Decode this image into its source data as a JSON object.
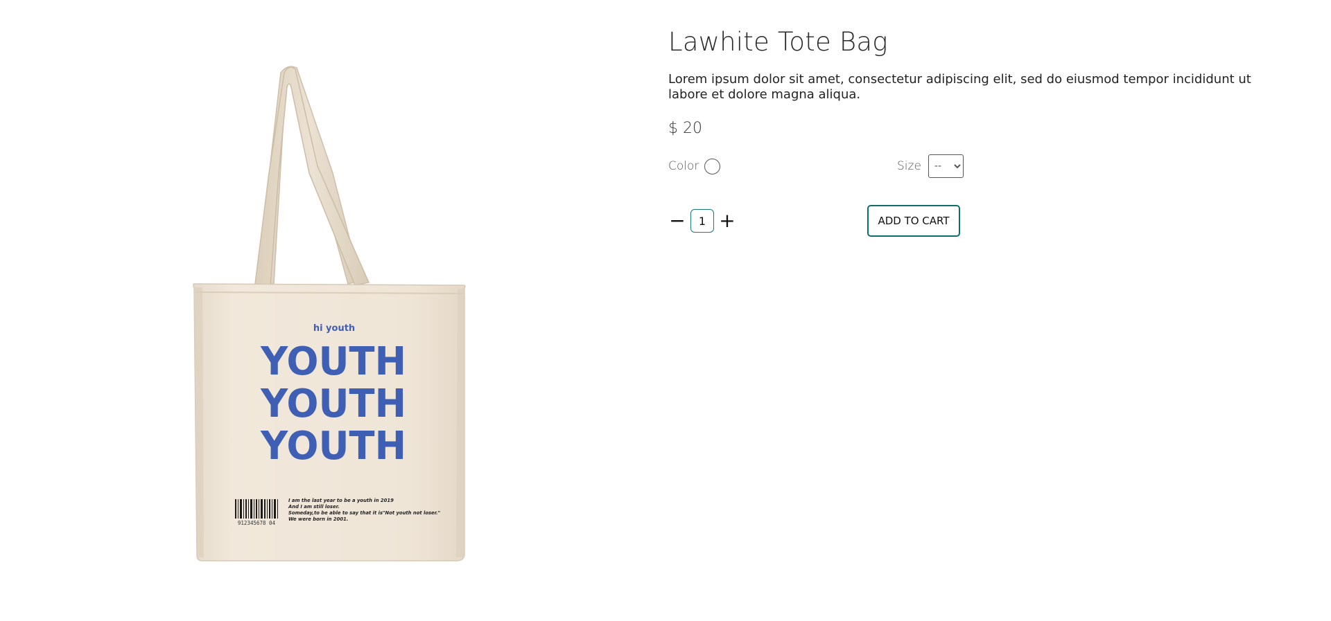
{
  "product": {
    "title": "Lawhite Tote Bag",
    "description": "Lorem ipsum dolor sit amet, consectetur adipiscing elit, sed do eiusmod tempor incididunt ut labore et dolore magna aliqua.",
    "price": "$ 20",
    "image": {
      "small_text": "hi youth",
      "big_text_lines": [
        "YOUTH",
        "YOUTH",
        "YOUTH"
      ],
      "barcode_number": "912345678 04",
      "fine_print": [
        "I am the last year to be a youth in 2019",
        "And I am still loser.",
        "Someday,to be able to say that it is\"Not youth not loser.\"",
        "We were born in 2001."
      ],
      "colors": {
        "canvas": "#efe5d7",
        "print_blue": "#3f5fb4"
      }
    }
  },
  "options": {
    "color_label": "Color",
    "size_label": "Size",
    "size_selected": "--"
  },
  "cart": {
    "decrement_label": "−",
    "quantity": "1",
    "increment_label": "+",
    "add_label": "ADD TO CART",
    "accent_color": "#0f6d6d"
  }
}
